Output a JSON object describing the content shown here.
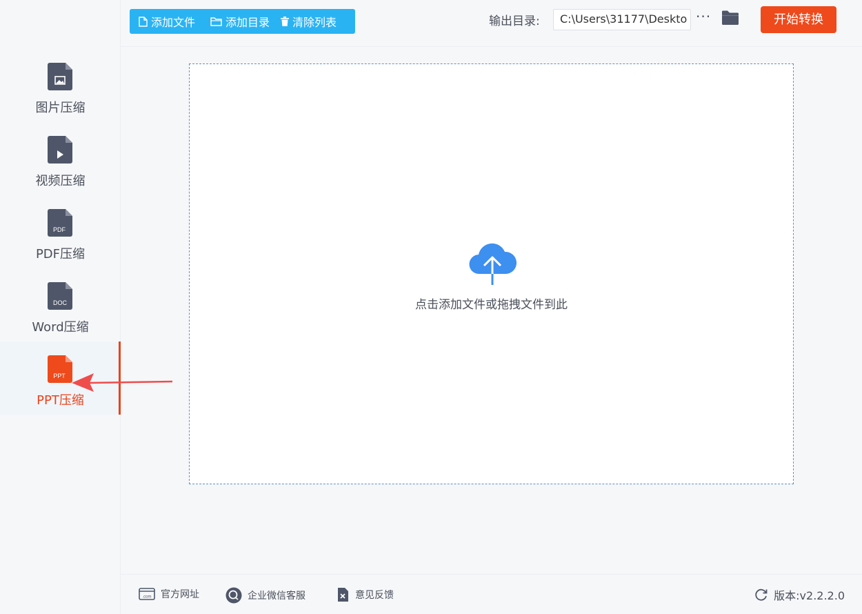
{
  "sidebar": {
    "items": [
      {
        "label": "图片压缩",
        "icon": "image-file-icon",
        "badge": ""
      },
      {
        "label": "视频压缩",
        "icon": "video-file-icon",
        "badge": ""
      },
      {
        "label": "PDF压缩",
        "icon": "pdf-file-icon",
        "badge": "PDF"
      },
      {
        "label": "Word压缩",
        "icon": "doc-file-icon",
        "badge": "DOC"
      },
      {
        "label": "PPT压缩",
        "icon": "ppt-file-icon",
        "badge": "PPT",
        "active": true
      }
    ]
  },
  "toolbar": {
    "add_file": "添加文件",
    "add_folder": "添加目录",
    "clear_list": "清除列表",
    "output_label": "输出目录:",
    "output_path": "C:\\Users\\31177\\Deskto",
    "more": "···",
    "start": "开始转换"
  },
  "dropzone": {
    "hint": "点击添加文件或拖拽文件到此"
  },
  "footer": {
    "website": "官方网址",
    "wechat": "企业微信客服",
    "feedback": "意见反馈",
    "version": "版本:v2.2.2.0"
  },
  "colors": {
    "accent_blue": "#2ab3f3",
    "accent_red": "#ee4a1c",
    "icon_gray": "#4f5669",
    "cloud_blue": "#3d8ff0"
  }
}
